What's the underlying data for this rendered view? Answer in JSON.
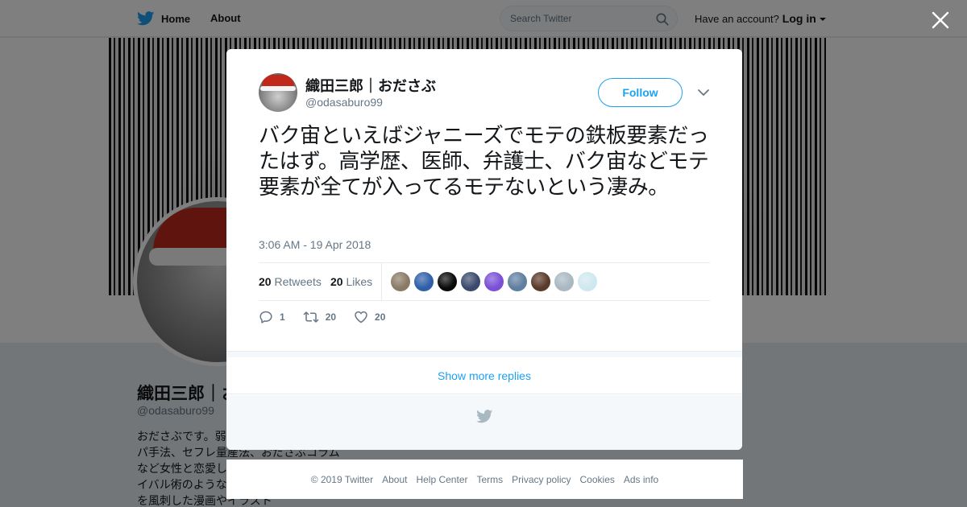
{
  "nav": {
    "home_label": "Home",
    "about_label": "About",
    "search_placeholder": "Search Twitter",
    "account_prompt": "Have an account?",
    "login_label": "Log in"
  },
  "profile": {
    "name": "織田三郎｜おださぶ",
    "handle": "@odasaburo99",
    "bio": "おださぶです。弱者の恋愛・ネットナンパ手法、セフレ量産法、おださぶコラムなど女性と恋愛して生き抜くためのサバイバル術のようなものを提案。男女問題を風刺した漫画やイラスト"
  },
  "tweet": {
    "author_name": "織田三郎｜おださぶ",
    "author_handle": "@odasaburo99",
    "follow_label": "Follow",
    "text": "バク宙といえばジャニーズでモテの鉄板要素だったはず。高学歴、医師、弁護士、バク宙などモテ要素が全てが入ってるモテないという凄み。",
    "timestamp": "3:06 AM - 19 Apr 2018",
    "retweets_count": "20",
    "retweets_label": "Retweets",
    "likes_count": "20",
    "likes_label": "Likes",
    "reply_count": "1",
    "retweet_action_count": "20",
    "like_action_count": "20"
  },
  "likers": [
    {
      "name": "liker-1",
      "color": "#8a7a66"
    },
    {
      "name": "liker-2",
      "color": "#2f5fa8"
    },
    {
      "name": "liker-3",
      "color": "#0a0a0a"
    },
    {
      "name": "liker-4",
      "color": "#3b4a6b"
    },
    {
      "name": "liker-5",
      "color": "#7b4fd6"
    },
    {
      "name": "liker-6",
      "color": "#5f7fa0"
    },
    {
      "name": "liker-7",
      "color": "#5a3a2a"
    },
    {
      "name": "liker-8",
      "color": "#aab8c2"
    },
    {
      "name": "liker-9",
      "color": "#cfe8ef"
    }
  ],
  "show_more_label": "Show more replies",
  "footer": {
    "copyright": "© 2019 Twitter",
    "links": [
      "About",
      "Help Center",
      "Terms",
      "Privacy policy",
      "Cookies",
      "Ads info"
    ]
  },
  "colors": {
    "accent": "#1da1f2",
    "text_secondary": "#657786",
    "overlay": "rgba(0,0,0,0.5)"
  }
}
